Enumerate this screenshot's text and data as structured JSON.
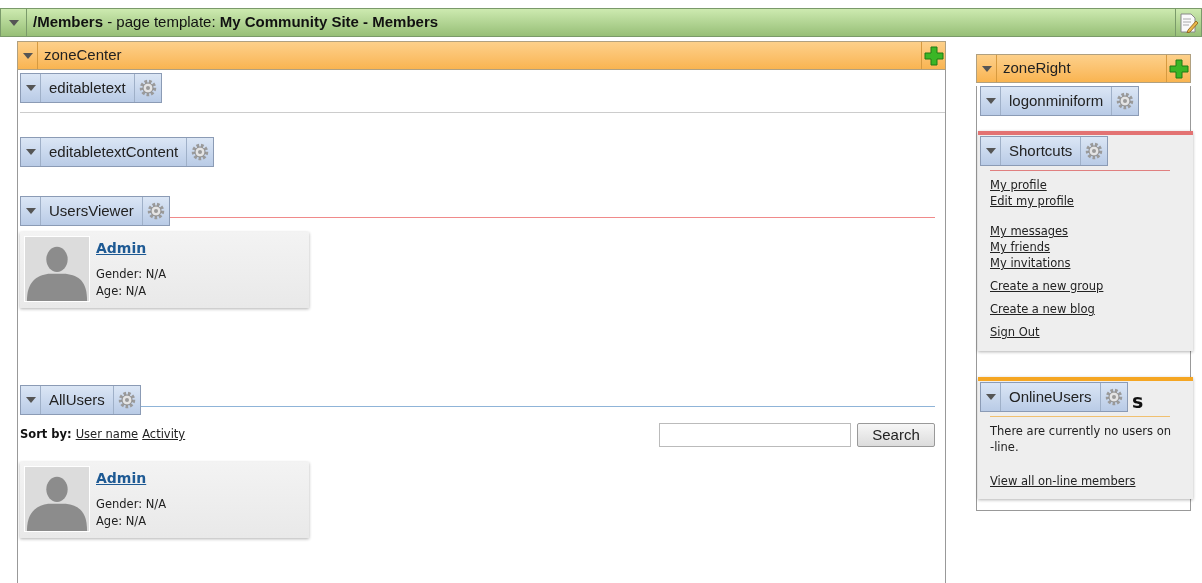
{
  "page_bar": {
    "title": "**/Members** - page template: **My Community Site - Members**"
  },
  "center_zone": {
    "title": "zoneCenter",
    "webparts": [
      {
        "kind": "text",
        "title": "editabletext"
      },
      {
        "kind": "content",
        "title": "editabletextContent"
      },
      {
        "kind": "users",
        "title": "UsersViewer",
        "users": [
          {
            "name": "Admin",
            "gender": "Gender: N/A",
            "age": "Age: N/A"
          }
        ]
      },
      {
        "kind": "directory",
        "title": "AllUsers",
        "sort_label": "Sort by:",
        "sort_links": [
          "User name",
          "Activity"
        ],
        "search_button": "Search",
        "users": [
          {
            "name": "Admin",
            "gender": "Gender: N/A",
            "age": "Age: N/A"
          }
        ]
      }
    ]
  },
  "right_zone": {
    "title": "zoneRight",
    "webparts": [
      {
        "kind": "form",
        "title": "logonminiform"
      },
      {
        "kind": "links",
        "title": "Shortcuts",
        "link_groups": [
          [
            "My profile",
            "Edit my profile"
          ],
          [
            "My messages",
            "My friends",
            "My invitations"
          ],
          [
            "Create a new group"
          ],
          [
            "Create a new blog"
          ],
          [
            "Sign Out"
          ]
        ]
      },
      {
        "kind": "online",
        "title": "OnlineUsers",
        "heading": "s",
        "message": "There are currently no users on -line.",
        "link": "View all on-line members"
      }
    ]
  }
}
